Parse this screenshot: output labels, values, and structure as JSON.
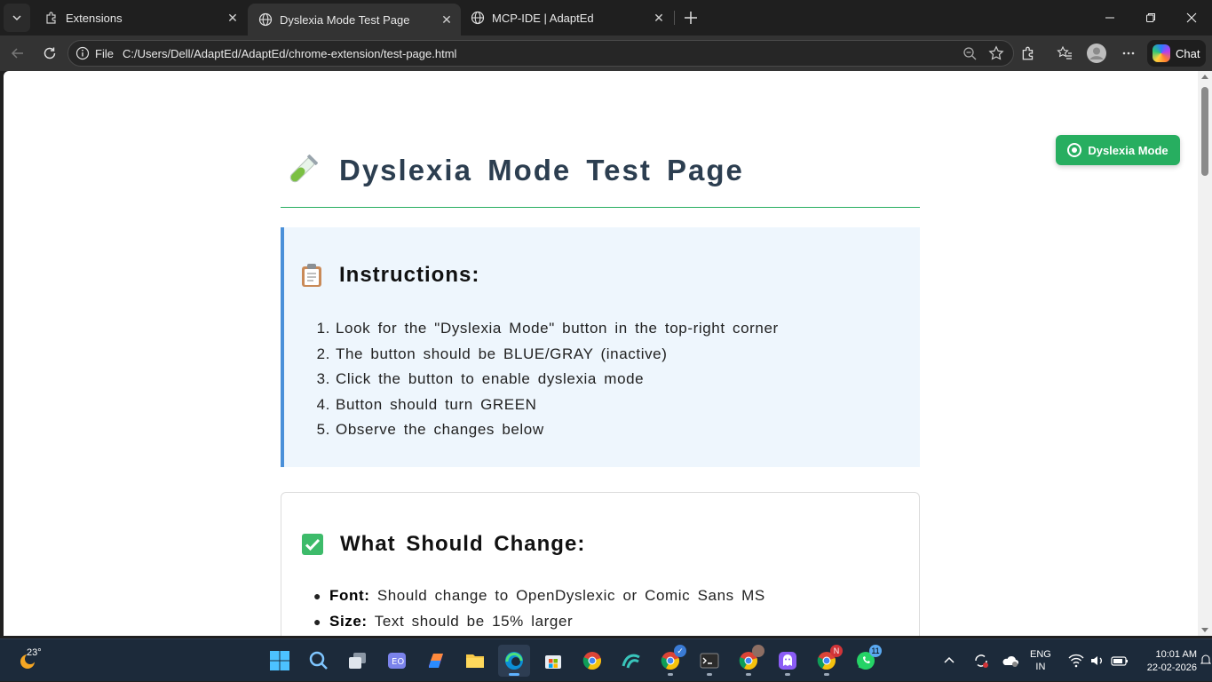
{
  "browser": {
    "tabs": [
      {
        "title": "Extensions",
        "active": false,
        "icon": "extensions-icon"
      },
      {
        "title": "Dyslexia Mode Test Page",
        "active": true,
        "icon": "globe-icon"
      },
      {
        "title": "MCP-IDE | AdaptEd",
        "active": false,
        "icon": "globe-icon"
      }
    ],
    "address": {
      "scheme": "File",
      "url": "C:/Users/Dell/AdaptEd/AdaptEd/chrome-extension/test-page.html"
    },
    "chat_label": "Chat"
  },
  "page": {
    "dyslexia_button": "Dyslexia Mode",
    "title": "Dyslexia Mode Test Page",
    "instructions": {
      "heading": "Instructions:",
      "items": [
        "Look for the \"Dyslexia Mode\" button in the top-right corner",
        "The button should be BLUE/GRAY (inactive)",
        "Click the button to enable dyslexia mode",
        "Button should turn GREEN",
        "Observe the changes below"
      ]
    },
    "changes": {
      "heading": "What Should Change:",
      "items": [
        {
          "label": "Font:",
          "text": "Should change to OpenDyslexic or Comic Sans MS"
        },
        {
          "label": "Size:",
          "text": "Text should be 15% larger"
        }
      ]
    },
    "colors": {
      "accent_green": "#27ae60",
      "instruction_bg": "#eef6fd",
      "instruction_border": "#4a90d9"
    }
  },
  "taskbar": {
    "weather_temp": "23°",
    "language": [
      "ENG",
      "IN"
    ],
    "time": "10:01 AM",
    "date": "22-02-2026",
    "badges": {
      "whatsapp": "11",
      "chrome_profile": "N"
    }
  }
}
